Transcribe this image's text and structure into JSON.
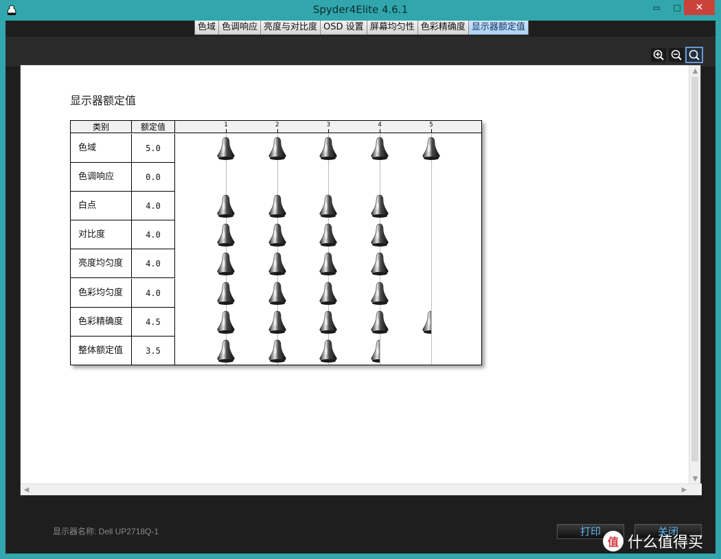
{
  "window": {
    "title": "Spyder4Elite 4.6.1",
    "minimize_glyph": "▭",
    "maximize_glyph": "□",
    "close_glyph": "✕"
  },
  "tabs": [
    {
      "label": "色域",
      "active": false
    },
    {
      "label": "色调响应",
      "active": false
    },
    {
      "label": "亮度与对比度",
      "active": false
    },
    {
      "label": "OSD 设置",
      "active": false
    },
    {
      "label": "屏幕均匀性",
      "active": false
    },
    {
      "label": "色彩精确度",
      "active": false
    },
    {
      "label": "显示器额定值",
      "active": true
    }
  ],
  "toolbar": {
    "icons": [
      "zoom-in-icon",
      "zoom-out-icon",
      "zoom-fit-icon"
    ]
  },
  "report": {
    "title": "显示器额定值",
    "headers": {
      "category": "类别",
      "rating": "额定值"
    },
    "scale_ticks": [
      "1",
      "2",
      "3",
      "4",
      "5"
    ],
    "rows": [
      {
        "category": "色域",
        "rating": "5.0",
        "value": 5.0
      },
      {
        "category": "色调响应",
        "rating": "0.0",
        "value": 0.0
      },
      {
        "category": "白点",
        "rating": "4.0",
        "value": 4.0
      },
      {
        "category": "对比度",
        "rating": "4.0",
        "value": 4.0
      },
      {
        "category": "亮度均匀度",
        "rating": "4.0",
        "value": 4.0
      },
      {
        "category": "色彩均匀度",
        "rating": "4.0",
        "value": 4.0
      },
      {
        "category": "色彩精确度",
        "rating": "4.5",
        "value": 4.5
      },
      {
        "category": "整体额定值",
        "rating": "3.5",
        "value": 3.5
      }
    ]
  },
  "footer": {
    "display_name": "显示器名称: Dell UP2718Q-1",
    "print_label": "打印",
    "close_label": "关闭"
  },
  "watermark": {
    "logo_text": "值",
    "text": "什么值得买"
  },
  "colors": {
    "frame": "#31a7ad",
    "accent_text": "#5ab4f0",
    "active_tab": "#a9d2f4"
  }
}
